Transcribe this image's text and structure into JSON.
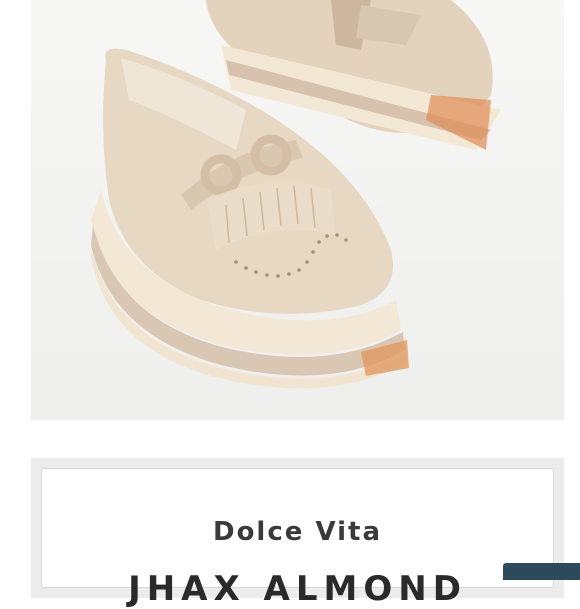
{
  "product": {
    "brand": "Dolce Vita",
    "name": "JHAX ALMOND"
  },
  "image": {
    "icon": "product-photo-sneaker"
  },
  "colors": {
    "suede": "#e6d8c3",
    "stripe_light": "#f3e8d6",
    "stripe_dark": "#d9c7b3",
    "badge": "#2d4a5c"
  }
}
